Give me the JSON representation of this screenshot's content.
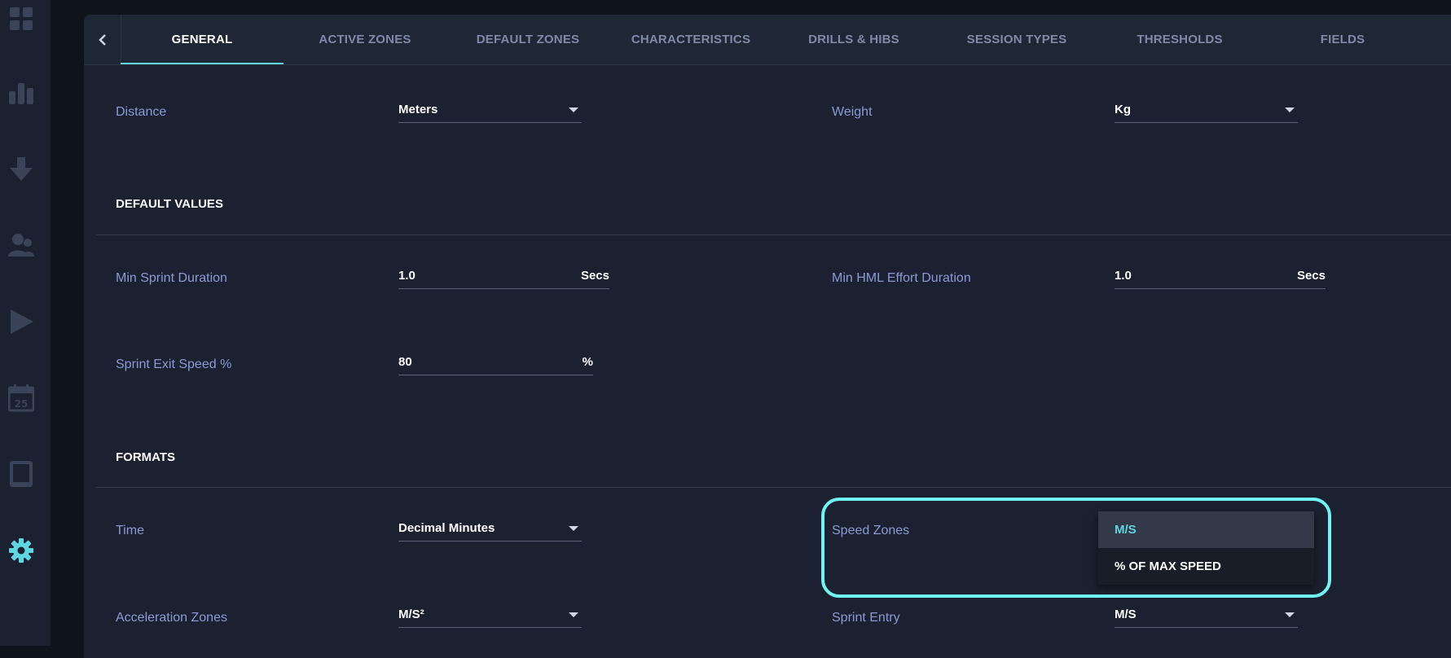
{
  "sidebar": {
    "items": [
      {
        "icon": "grid-icon"
      },
      {
        "icon": "bar-chart-icon"
      },
      {
        "icon": "download-icon"
      },
      {
        "icon": "users-icon"
      },
      {
        "icon": "play-icon"
      },
      {
        "icon": "calendar-icon",
        "calendar_day": "25"
      },
      {
        "icon": "tablet-icon"
      },
      {
        "icon": "gear-icon"
      }
    ],
    "active_color": "#5fd6e0",
    "icon_color": "#3a4358"
  },
  "tabs": {
    "active": "GENERAL",
    "items": [
      "GENERAL",
      "ACTIVE ZONES",
      "DEFAULT ZONES",
      "CHARACTERISTICS",
      "DRILLS & HIBS",
      "SESSION TYPES",
      "THRESHOLDS",
      "FIELDS"
    ]
  },
  "units": {
    "distance_label": "Distance",
    "distance_value": "Meters",
    "weight_label": "Weight",
    "weight_value": "Kg"
  },
  "default_values": {
    "heading": "DEFAULT VALUES",
    "min_sprint_label": "Min Sprint Duration",
    "min_sprint_value": "1.0",
    "min_sprint_unit": "Secs",
    "min_hml_label": "Min HML Effort Duration",
    "min_hml_value": "1.0",
    "min_hml_unit": "Secs",
    "sprint_exit_label": "Sprint Exit Speed %",
    "sprint_exit_value": "80",
    "sprint_exit_unit": "%"
  },
  "formats": {
    "heading": "FORMATS",
    "time_label": "Time",
    "time_value": "Decimal Minutes",
    "speed_zones_label": "Speed Zones",
    "speed_zones_options": [
      "M/S",
      "% OF MAX SPEED"
    ],
    "acceleration_label": "Acceleration Zones",
    "acceleration_value": "M/S²",
    "sprint_entry_label": "Sprint Entry",
    "sprint_entry_value": "M/S"
  },
  "colors": {
    "accent": "#5fd6e0",
    "highlight": "#6ff3f3",
    "label": "#8b9ad4"
  }
}
